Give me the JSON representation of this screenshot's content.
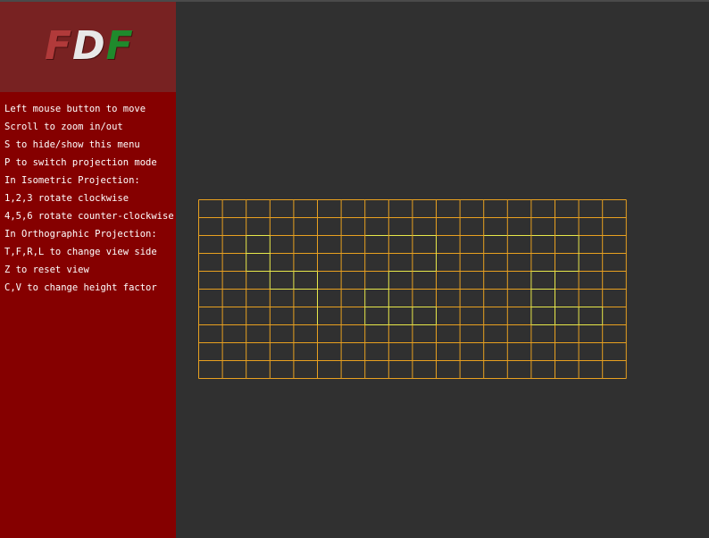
{
  "window": {
    "background": "#303030",
    "sidebar_color": "#850000",
    "logo_panel_color": "#782222"
  },
  "logo": {
    "letters": [
      "F",
      "D",
      "F"
    ],
    "colors": [
      "#b13a3a",
      "#e8e8e8",
      "#1f8a2c"
    ]
  },
  "help": {
    "lines": [
      "Left mouse button to move",
      "Scroll to zoom in/out",
      "S to hide/show this menu",
      "P to switch projection mode",
      "In Isometric Projection:",
      "1,2,3 rotate clockwise",
      "4,5,6 rotate counter-clockwise",
      "In Orthographic Projection:",
      "T,F,R,L to change view side",
      "Z to reset view",
      "C,V to change height factor"
    ]
  },
  "map": {
    "projection": "orthographic-top",
    "columns": 19,
    "rows": 11,
    "edge_color": "#e8a020",
    "raised_color": "#e8e84a",
    "heights": [
      [
        0,
        0,
        0,
        0,
        0,
        0,
        0,
        0,
        0,
        0,
        0,
        0,
        0,
        0,
        0,
        0,
        0,
        0,
        0
      ],
      [
        0,
        0,
        0,
        0,
        0,
        0,
        0,
        0,
        0,
        0,
        0,
        0,
        0,
        0,
        0,
        0,
        0,
        0,
        0
      ],
      [
        0,
        0,
        10,
        10,
        0,
        0,
        0,
        10,
        10,
        10,
        10,
        0,
        10,
        10,
        10,
        10,
        10,
        0,
        0
      ],
      [
        0,
        0,
        10,
        10,
        0,
        0,
        0,
        0,
        0,
        0,
        10,
        0,
        0,
        0,
        0,
        0,
        10,
        0,
        0
      ],
      [
        0,
        0,
        10,
        10,
        10,
        10,
        0,
        0,
        10,
        10,
        10,
        0,
        0,
        0,
        10,
        10,
        10,
        0,
        0
      ],
      [
        0,
        0,
        0,
        10,
        10,
        10,
        0,
        10,
        10,
        0,
        0,
        0,
        0,
        0,
        10,
        10,
        0,
        0,
        0
      ],
      [
        0,
        0,
        0,
        0,
        0,
        10,
        0,
        10,
        10,
        10,
        10,
        0,
        0,
        0,
        10,
        10,
        10,
        10,
        0
      ],
      [
        0,
        0,
        0,
        0,
        0,
        10,
        0,
        10,
        10,
        10,
        10,
        0,
        0,
        0,
        10,
        10,
        10,
        10,
        0
      ],
      [
        0,
        0,
        0,
        0,
        0,
        0,
        0,
        0,
        0,
        0,
        0,
        0,
        0,
        0,
        0,
        0,
        0,
        0,
        0
      ],
      [
        0,
        0,
        0,
        0,
        0,
        0,
        0,
        0,
        0,
        0,
        0,
        0,
        0,
        0,
        0,
        0,
        0,
        0,
        0
      ],
      [
        0,
        0,
        0,
        0,
        0,
        0,
        0,
        0,
        0,
        0,
        0,
        0,
        0,
        0,
        0,
        0,
        0,
        0,
        0
      ]
    ]
  }
}
